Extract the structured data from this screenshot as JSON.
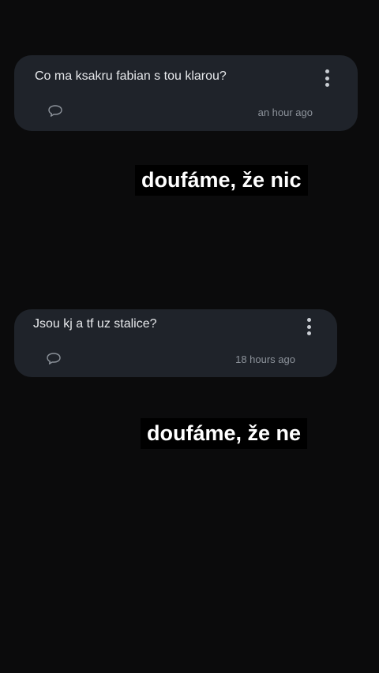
{
  "cards": [
    {
      "question": "Co ma ksakru fabian s tou klarou?",
      "timestamp": "an hour ago",
      "menu_icon": "more-vertical-icon",
      "comment_icon": "comment-icon"
    },
    {
      "question": "Jsou kj a tf uz stalice?",
      "timestamp": "18 hours ago",
      "menu_icon": "more-vertical-icon",
      "comment_icon": "comment-icon"
    }
  ],
  "answers": [
    "doufáme, že nic",
    "doufáme, že ne"
  ],
  "colors": {
    "background": "#0b0b0c",
    "card": "#1f232a",
    "question_text": "#e7e9ec",
    "meta_text": "#8d939b",
    "answer_bg": "#000000",
    "answer_text": "#ffffff"
  }
}
